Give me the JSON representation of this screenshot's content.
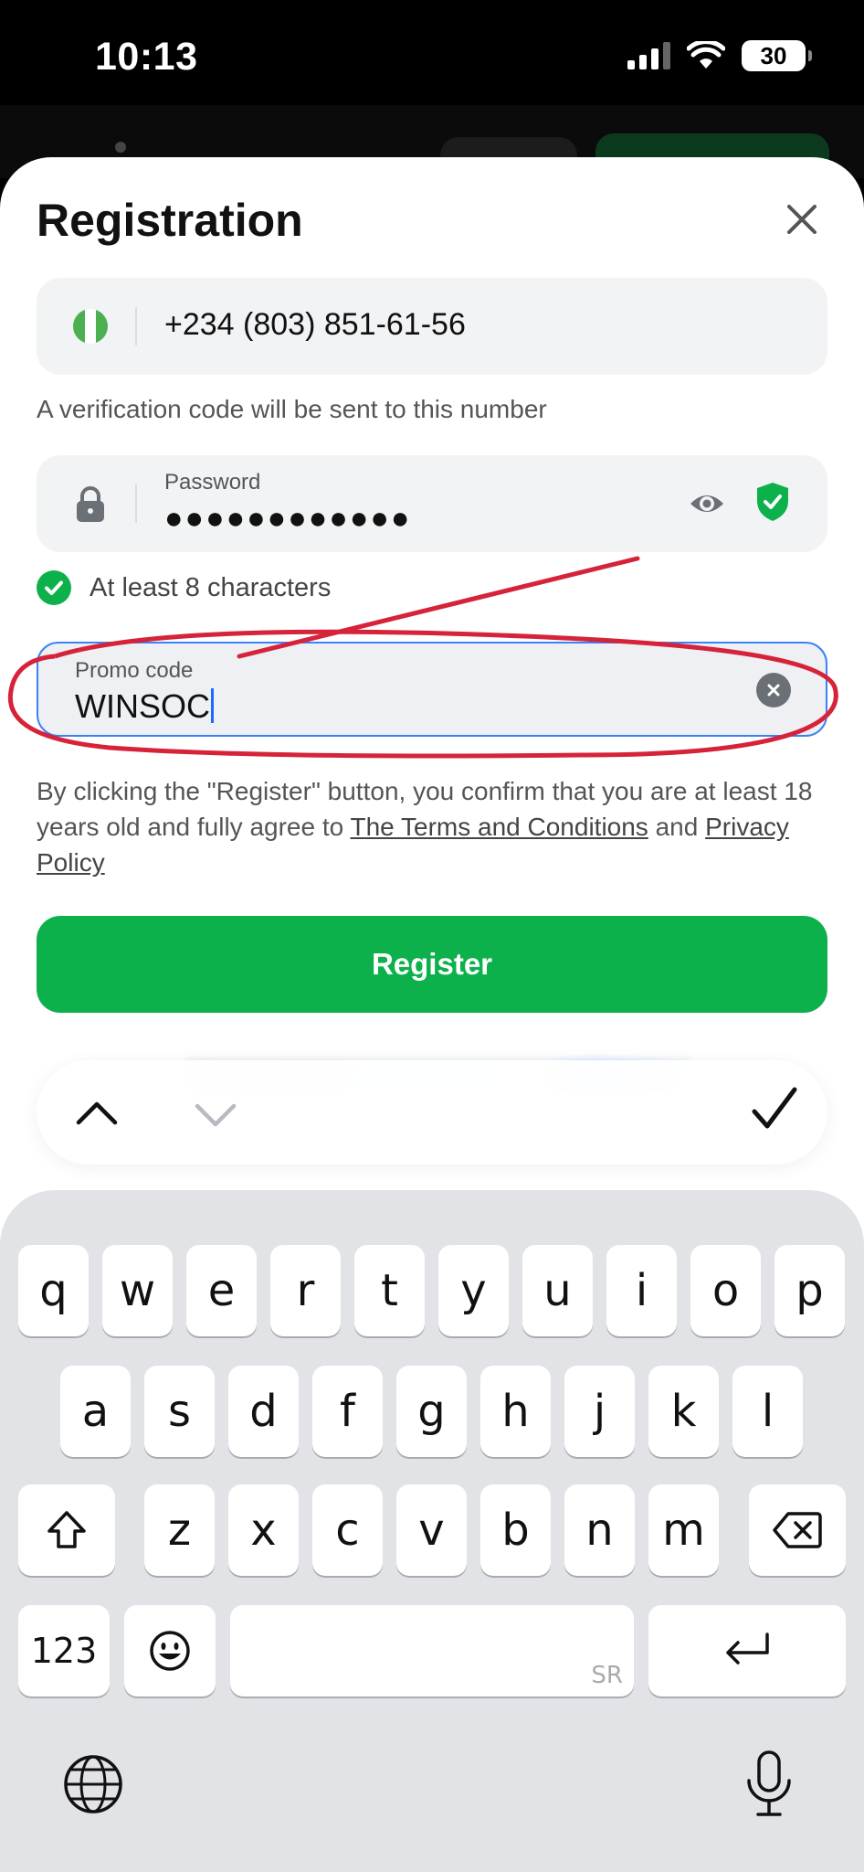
{
  "status_bar": {
    "time": "10:13",
    "battery": "30"
  },
  "header": {
    "title": "Registration"
  },
  "phone": {
    "number": "+234 (803) 851-61-56",
    "hint": "A verification code will be sent to this number"
  },
  "password": {
    "label": "Password",
    "masked_value": "●●●●●●●●●●●●"
  },
  "requirement": {
    "text": "At least 8 characters"
  },
  "promo": {
    "label": "Promo code",
    "value": "WINSOC"
  },
  "legal": {
    "prefix": "By clicking the \"Register\" button, you confirm that you are at least 18 years old and fully agree to ",
    "terms_link": "The Terms and Conditions",
    "middle": " and ",
    "privacy_link": "Privacy Policy"
  },
  "register": {
    "label": "Register"
  },
  "keyboard": {
    "row1": [
      "q",
      "w",
      "e",
      "r",
      "t",
      "y",
      "u",
      "i",
      "o",
      "p"
    ],
    "row2": [
      "a",
      "s",
      "d",
      "f",
      "g",
      "h",
      "j",
      "k",
      "l"
    ],
    "row3": [
      "z",
      "x",
      "c",
      "v",
      "b",
      "n",
      "m"
    ],
    "numbers_label": "123",
    "space_watermark": "SR"
  },
  "colors": {
    "accent_green": "#0db14b",
    "focus_blue": "#3b82f6",
    "annotation_red": "#d6233a"
  }
}
